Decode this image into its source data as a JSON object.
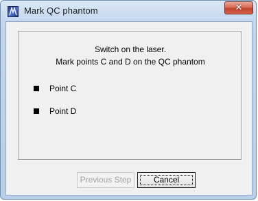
{
  "window": {
    "title": "Mark QC phantom",
    "icon": "app-logo-icon",
    "close_glyph": "✕"
  },
  "instructions": {
    "line1": "Switch on the laser.",
    "line2": "Mark points C and D on the QC phantom"
  },
  "points": [
    {
      "label": "Point C"
    },
    {
      "label": "Point D"
    }
  ],
  "buttons": {
    "previous_step": "Previous Step",
    "previous_step_enabled": false,
    "cancel": "Cancel"
  }
}
